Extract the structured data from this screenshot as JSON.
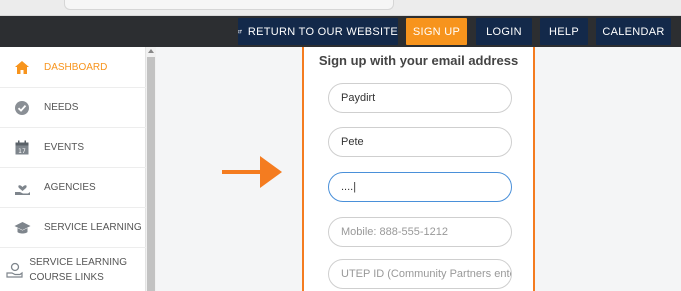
{
  "navbar": {
    "return_label": "RETURN TO OUR WEBSITE",
    "signup_label": "SIGN UP",
    "login_label": "LOGIN",
    "help_label": "HELP",
    "calendar_label": "CALENDAR"
  },
  "sidebar": {
    "items": [
      {
        "label": "DASHBOARD",
        "icon": "home-icon",
        "active": true
      },
      {
        "label": "NEEDS",
        "icon": "check-circle-icon"
      },
      {
        "label": "EVENTS",
        "icon": "calendar-icon"
      },
      {
        "label": "AGENCIES",
        "icon": "hand-heart-icon"
      },
      {
        "label": "SERVICE LEARNING",
        "icon": "graduation-cap-icon"
      },
      {
        "label": "SERVICE LEARNING COURSE LINKS",
        "icon": "hand-link-icon"
      }
    ]
  },
  "signup_form": {
    "title": "Sign up with your email address",
    "first_name_value": "Paydirt",
    "last_name_value": "Pete",
    "password_value": "....|",
    "mobile_placeholder": "Mobile: 888-555-1212",
    "utep_id_placeholder": "UTEP ID (Community Partners ente"
  },
  "colors": {
    "accent": "#f7941d",
    "navbar_bg": "#2c2e31",
    "nav_button": "#13294a",
    "annotation": "#f47c20",
    "focus_border": "#4a90d9"
  }
}
